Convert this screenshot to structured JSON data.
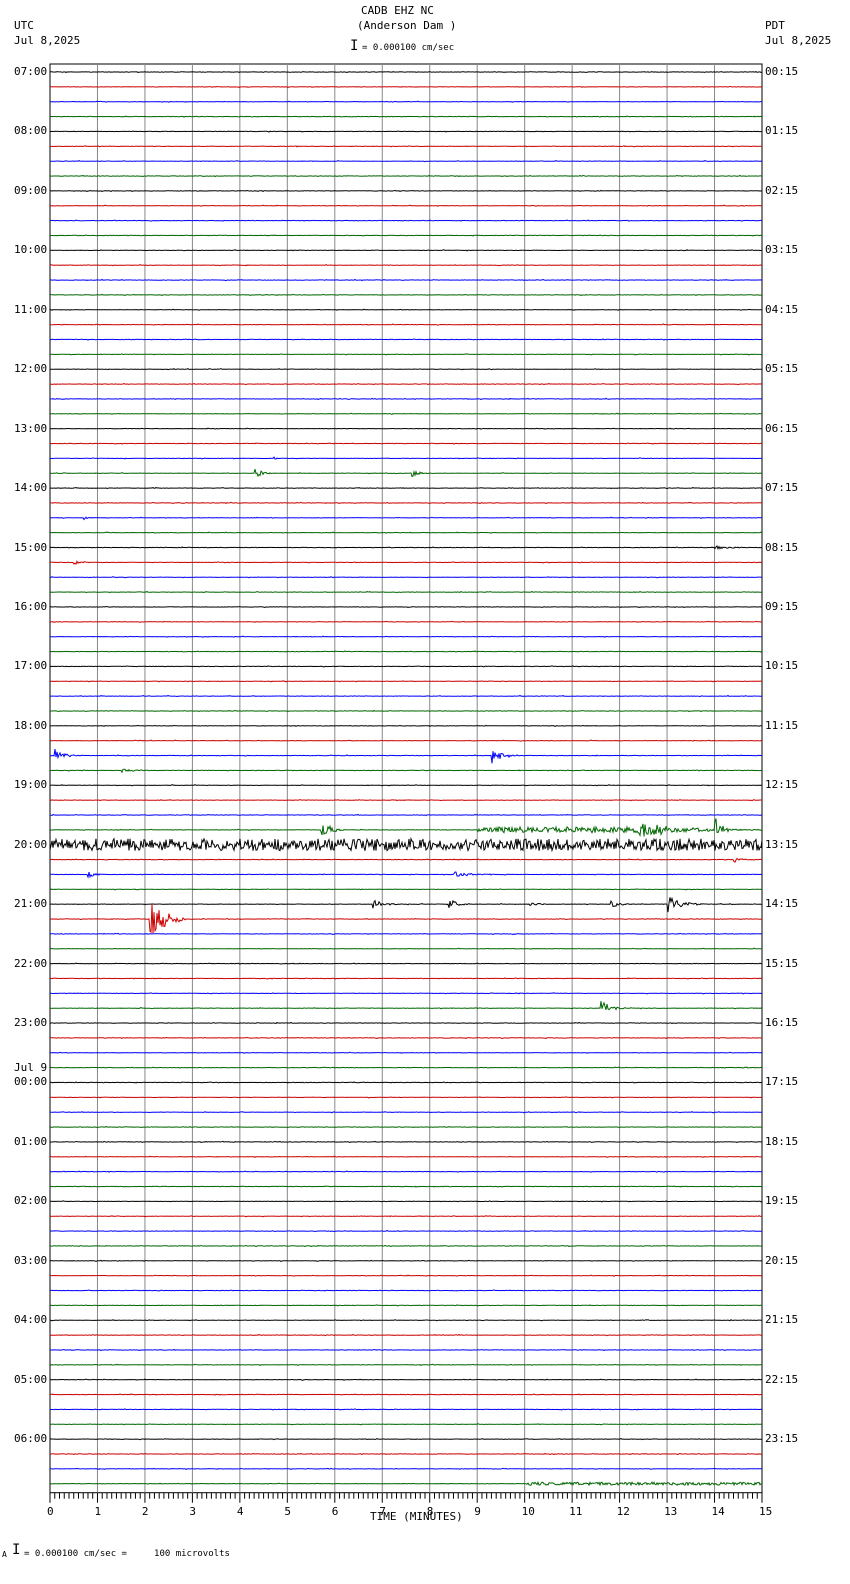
{
  "header": {
    "title": "CADB EHZ NC",
    "subtitle": "(Anderson Dam )",
    "left_tz": "UTC",
    "left_date": "Jul 8,2025",
    "right_tz": "PDT",
    "right_date": "Jul 8,2025",
    "scale_text": "= 0.000100 cm/sec"
  },
  "footer": {
    "scale_text": "= 0.000100 cm/sec =     100 microvolts",
    "prefix": "A"
  },
  "chart_data": {
    "type": "line",
    "title": "CADB EHZ NC (Anderson Dam )",
    "xlabel": "TIME (MINUTES)",
    "xlim": [
      0,
      15
    ],
    "x_ticks": [
      "0",
      "1",
      "2",
      "3",
      "4",
      "5",
      "6",
      "7",
      "8",
      "9",
      "10",
      "11",
      "12",
      "13",
      "14",
      "15"
    ],
    "trace_minutes": 15,
    "trace_count": 96,
    "trace_colors": [
      "#000000",
      "#cc0000",
      "#0000ff",
      "#006600"
    ],
    "left_labels": [
      {
        "row": 0,
        "text": "07:00"
      },
      {
        "row": 4,
        "text": "08:00"
      },
      {
        "row": 8,
        "text": "09:00"
      },
      {
        "row": 12,
        "text": "10:00"
      },
      {
        "row": 16,
        "text": "11:00"
      },
      {
        "row": 20,
        "text": "12:00"
      },
      {
        "row": 24,
        "text": "13:00"
      },
      {
        "row": 28,
        "text": "14:00"
      },
      {
        "row": 32,
        "text": "15:00"
      },
      {
        "row": 36,
        "text": "16:00"
      },
      {
        "row": 40,
        "text": "17:00"
      },
      {
        "row": 44,
        "text": "18:00"
      },
      {
        "row": 48,
        "text": "19:00"
      },
      {
        "row": 52,
        "text": "20:00"
      },
      {
        "row": 56,
        "text": "21:00"
      },
      {
        "row": 60,
        "text": "22:00"
      },
      {
        "row": 64,
        "text": "23:00"
      },
      {
        "row": 68,
        "text": "00:00",
        "date": "Jul 9"
      },
      {
        "row": 72,
        "text": "01:00"
      },
      {
        "row": 76,
        "text": "02:00"
      },
      {
        "row": 80,
        "text": "03:00"
      },
      {
        "row": 84,
        "text": "04:00"
      },
      {
        "row": 88,
        "text": "05:00"
      },
      {
        "row": 92,
        "text": "06:00"
      }
    ],
    "right_labels": [
      "00:15",
      "01:15",
      "02:15",
      "03:15",
      "04:15",
      "05:15",
      "06:15",
      "07:15",
      "08:15",
      "09:15",
      "10:15",
      "11:15",
      "12:15",
      "13:15",
      "14:15",
      "15:15",
      "16:15",
      "17:15",
      "18:15",
      "19:15",
      "20:15",
      "21:15",
      "22:15",
      "23:15"
    ],
    "events": [
      {
        "row": 26,
        "minute": 4.7,
        "amp": 6,
        "dur": 0.1
      },
      {
        "row": 27,
        "minute": 4.3,
        "amp": 6,
        "dur": 0.4
      },
      {
        "row": 27,
        "minute": 7.6,
        "amp": 5,
        "dur": 0.4
      },
      {
        "row": 30,
        "minute": 0.7,
        "amp": 2,
        "dur": 0.4
      },
      {
        "row": 32,
        "minute": 14.0,
        "amp": 2,
        "dur": 1.0
      },
      {
        "row": 33,
        "minute": 0.5,
        "amp": 2,
        "dur": 0.6
      },
      {
        "row": 46,
        "minute": 0.1,
        "amp": 8,
        "dur": 0.5
      },
      {
        "row": 46,
        "minute": 9.3,
        "amp": 10,
        "dur": 0.6
      },
      {
        "row": 47,
        "minute": 1.5,
        "amp": 2,
        "dur": 1.0
      },
      {
        "row": 51,
        "minute": 5.7,
        "amp": 12,
        "dur": 0.5
      },
      {
        "row": 51,
        "minute": 9.0,
        "amp": 3,
        "dur": 3.5
      },
      {
        "row": 51,
        "minute": 12.4,
        "amp": 8,
        "dur": 2.6
      },
      {
        "row": 51,
        "minute": 14.0,
        "amp": 16,
        "dur": 0.4
      },
      {
        "row": 52,
        "minute": 0.0,
        "amp": 6,
        "dur": 15
      },
      {
        "row": 53,
        "minute": 14.4,
        "amp": 3,
        "dur": 0.6
      },
      {
        "row": 54,
        "minute": 0.8,
        "amp": 4,
        "dur": 0.4
      },
      {
        "row": 54,
        "minute": 8.5,
        "amp": 4,
        "dur": 0.8
      },
      {
        "row": 56,
        "minute": 6.8,
        "amp": 5,
        "dur": 0.6
      },
      {
        "row": 56,
        "minute": 8.4,
        "amp": 6,
        "dur": 0.5
      },
      {
        "row": 56,
        "minute": 10.1,
        "amp": 4,
        "dur": 0.4
      },
      {
        "row": 56,
        "minute": 11.8,
        "amp": 4,
        "dur": 0.6
      },
      {
        "row": 56,
        "minute": 13.0,
        "amp": 9,
        "dur": 0.8
      },
      {
        "row": 57,
        "minute": 2.1,
        "amp": 28,
        "dur": 0.8
      },
      {
        "row": 63,
        "minute": 11.6,
        "amp": 10,
        "dur": 0.5
      },
      {
        "row": 95,
        "minute": 10.0,
        "amp": 1.5,
        "dur": 5
      }
    ]
  }
}
